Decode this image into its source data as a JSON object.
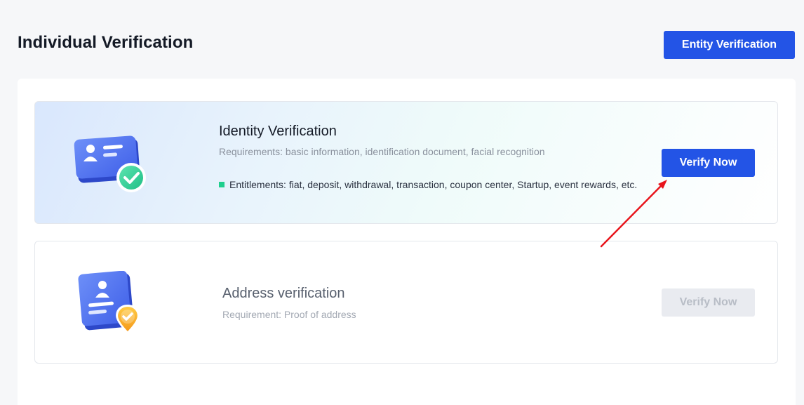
{
  "header": {
    "title": "Individual Verification",
    "entity_button": "Entity Verification"
  },
  "cards": [
    {
      "title": "Identity Verification",
      "requirement": "Requirements: basic information, identification document, facial recognition",
      "entitlements": "Entitlements: fiat, deposit, withdrawal, transaction, coupon center, Startup, event rewards, etc.",
      "button": "Verify Now",
      "button_enabled": true,
      "icon": "id-card-check-icon"
    },
    {
      "title": "Address verification",
      "requirement": "Requirement: Proof of address",
      "button": "Verify Now",
      "button_enabled": false,
      "icon": "address-document-pin-icon"
    }
  ],
  "colors": {
    "primary": "#2354e6",
    "success": "#1fcf8e",
    "annotation_arrow": "#e8141b"
  }
}
